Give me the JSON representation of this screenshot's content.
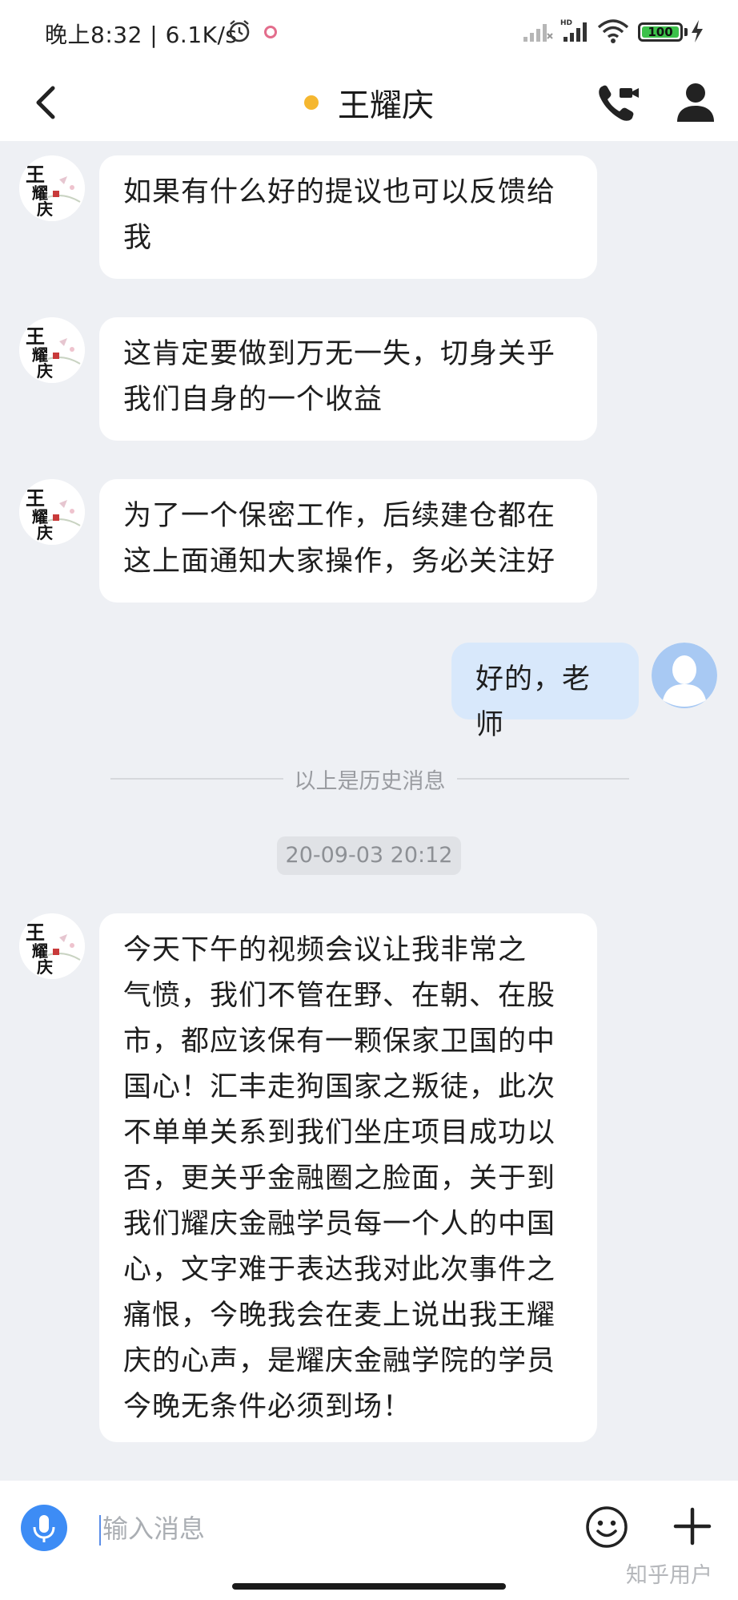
{
  "status_bar": {
    "time_speed": "晚上8:32 | 6.1K/s",
    "battery": "100"
  },
  "header": {
    "title": "王耀庆"
  },
  "messages": [
    {
      "sender": "other",
      "text_lines": [
        "如果有什么好的提议也可以反馈给",
        "我"
      ]
    },
    {
      "sender": "other",
      "text_lines": [
        "这肯定要做到万无一失，切身关乎",
        "我们自身的一个收益"
      ]
    },
    {
      "sender": "other",
      "text_lines": [
        "为了一个保密工作，后续建仓都在",
        "这上面通知大家操作，务必关注好"
      ]
    },
    {
      "sender": "me",
      "text_lines": [
        "好的，老师"
      ]
    },
    {
      "sender": "other",
      "text_lines": [
        "今天下午的视频会议让我非常之",
        "气愤，我们不管在野、在朝、在股",
        "市，都应该保有一颗保家卫国的中",
        "国心！汇丰走狗国家之叛徒，此次",
        "不单单关系到我们坐庄项目成功以",
        "否，更关乎金融圈之脸面，关于到",
        "我们耀庆金融学员每一个人的中国",
        "心，文字难于表达我对此次事件之",
        "痛恨，今晚我会在麦上说出我王耀",
        "庆的心声，是耀庆金融学院的学员",
        "今晚无条件必须到场！"
      ]
    }
  ],
  "history_divider": "以上是历史消息",
  "timestamp": "20-09-03 20:12",
  "avatar_seal_text": "王耀庆",
  "input": {
    "placeholder": "输入消息"
  },
  "watermark": "知乎用户",
  "colors": {
    "accent_blue": "#3d8cf5",
    "online_dot": "#f5b730",
    "my_bubble": "#d8e8fb",
    "background": "#eef0f4"
  },
  "icons": [
    "back-arrow-icon",
    "video-call-icon",
    "profile-icon",
    "mic-icon",
    "emoji-icon",
    "plus-icon"
  ]
}
